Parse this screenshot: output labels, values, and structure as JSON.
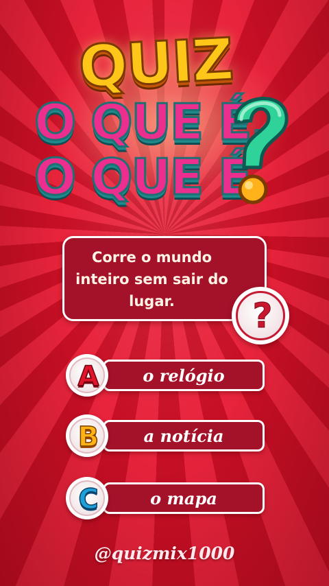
{
  "title": {
    "line1": "QUIZ",
    "line2": "O QUE É,",
    "line3": "O QUE É",
    "mark": "?"
  },
  "question": {
    "text": "Corre o mundo inteiro sem sair do lugar.",
    "badge_symbol": "?"
  },
  "options": [
    {
      "letter": "A",
      "label": "o relógio"
    },
    {
      "letter": "B",
      "label": "a notícia"
    },
    {
      "letter": "C",
      "label": "o mapa"
    }
  ],
  "footer": {
    "handle": "@quizmix1000"
  },
  "colors": {
    "background": "#d9142b",
    "card": "#a4122a",
    "title_yellow": "#ffc61a",
    "title_pink": "#ec2f8f",
    "title_teal": "#1f8a8c",
    "question_mark_green": "#2fd39a"
  }
}
